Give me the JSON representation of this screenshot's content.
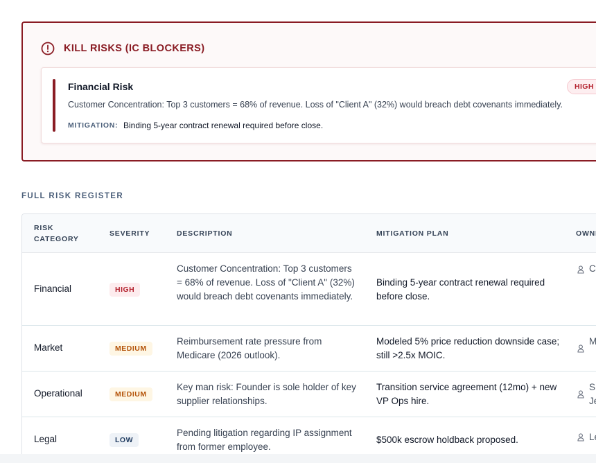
{
  "kill_risks": {
    "title": "KILL RISKS (IC BLOCKERS)",
    "card": {
      "title": "Financial Risk",
      "severity": "HIGH SEVERITY",
      "description": "Customer Concentration: Top 3 customers = 68% of revenue. Loss of \"Client A\" (32%) would breach debt covenants immediately.",
      "mitigation_label": "MITIGATION:",
      "mitigation_text": "Binding 5-year contract renewal required before close."
    }
  },
  "register": {
    "section_title": "FULL RISK REGISTER",
    "columns": {
      "category": "RISK CATEGORY",
      "severity": "SEVERITY",
      "description": "DESCRIPTION",
      "mitigation": "MITIGATION PLAN",
      "owner": "OWNER"
    },
    "rows": [
      {
        "category": "Financial",
        "severity": "HIGH",
        "description": "Customer Concentration: Top 3 customers = 68% of revenue. Loss of \"Client A\" (32%) would breach debt covenants immediately.",
        "mitigation": "Binding 5-year contract renewal required before close.",
        "owner": "C"
      },
      {
        "category": "Market",
        "severity": "MEDIUM",
        "description": "Reimbursement rate pressure from Medicare (2026 outlook).",
        "mitigation": "Modeled 5% price reduction downside case; still >2.5x MOIC.",
        "owner": "M C"
      },
      {
        "category": "Operational",
        "severity": "MEDIUM",
        "description": "Key man risk: Founder is sole holder of key supplier relationships.",
        "mitigation": "Transition service agreement (12mo) + new VP Ops hire.",
        "owner": "S. Je"
      },
      {
        "category": "Legal",
        "severity": "LOW",
        "description": "Pending litigation regarding IP assignment from former employee.",
        "mitigation": "$500k escrow holdback proposed.",
        "owner": "Le"
      }
    ]
  },
  "colors": {
    "accent": "#8a1c24",
    "high": "#b4232f",
    "medium": "#b45309",
    "low": "#1e3a5f"
  }
}
